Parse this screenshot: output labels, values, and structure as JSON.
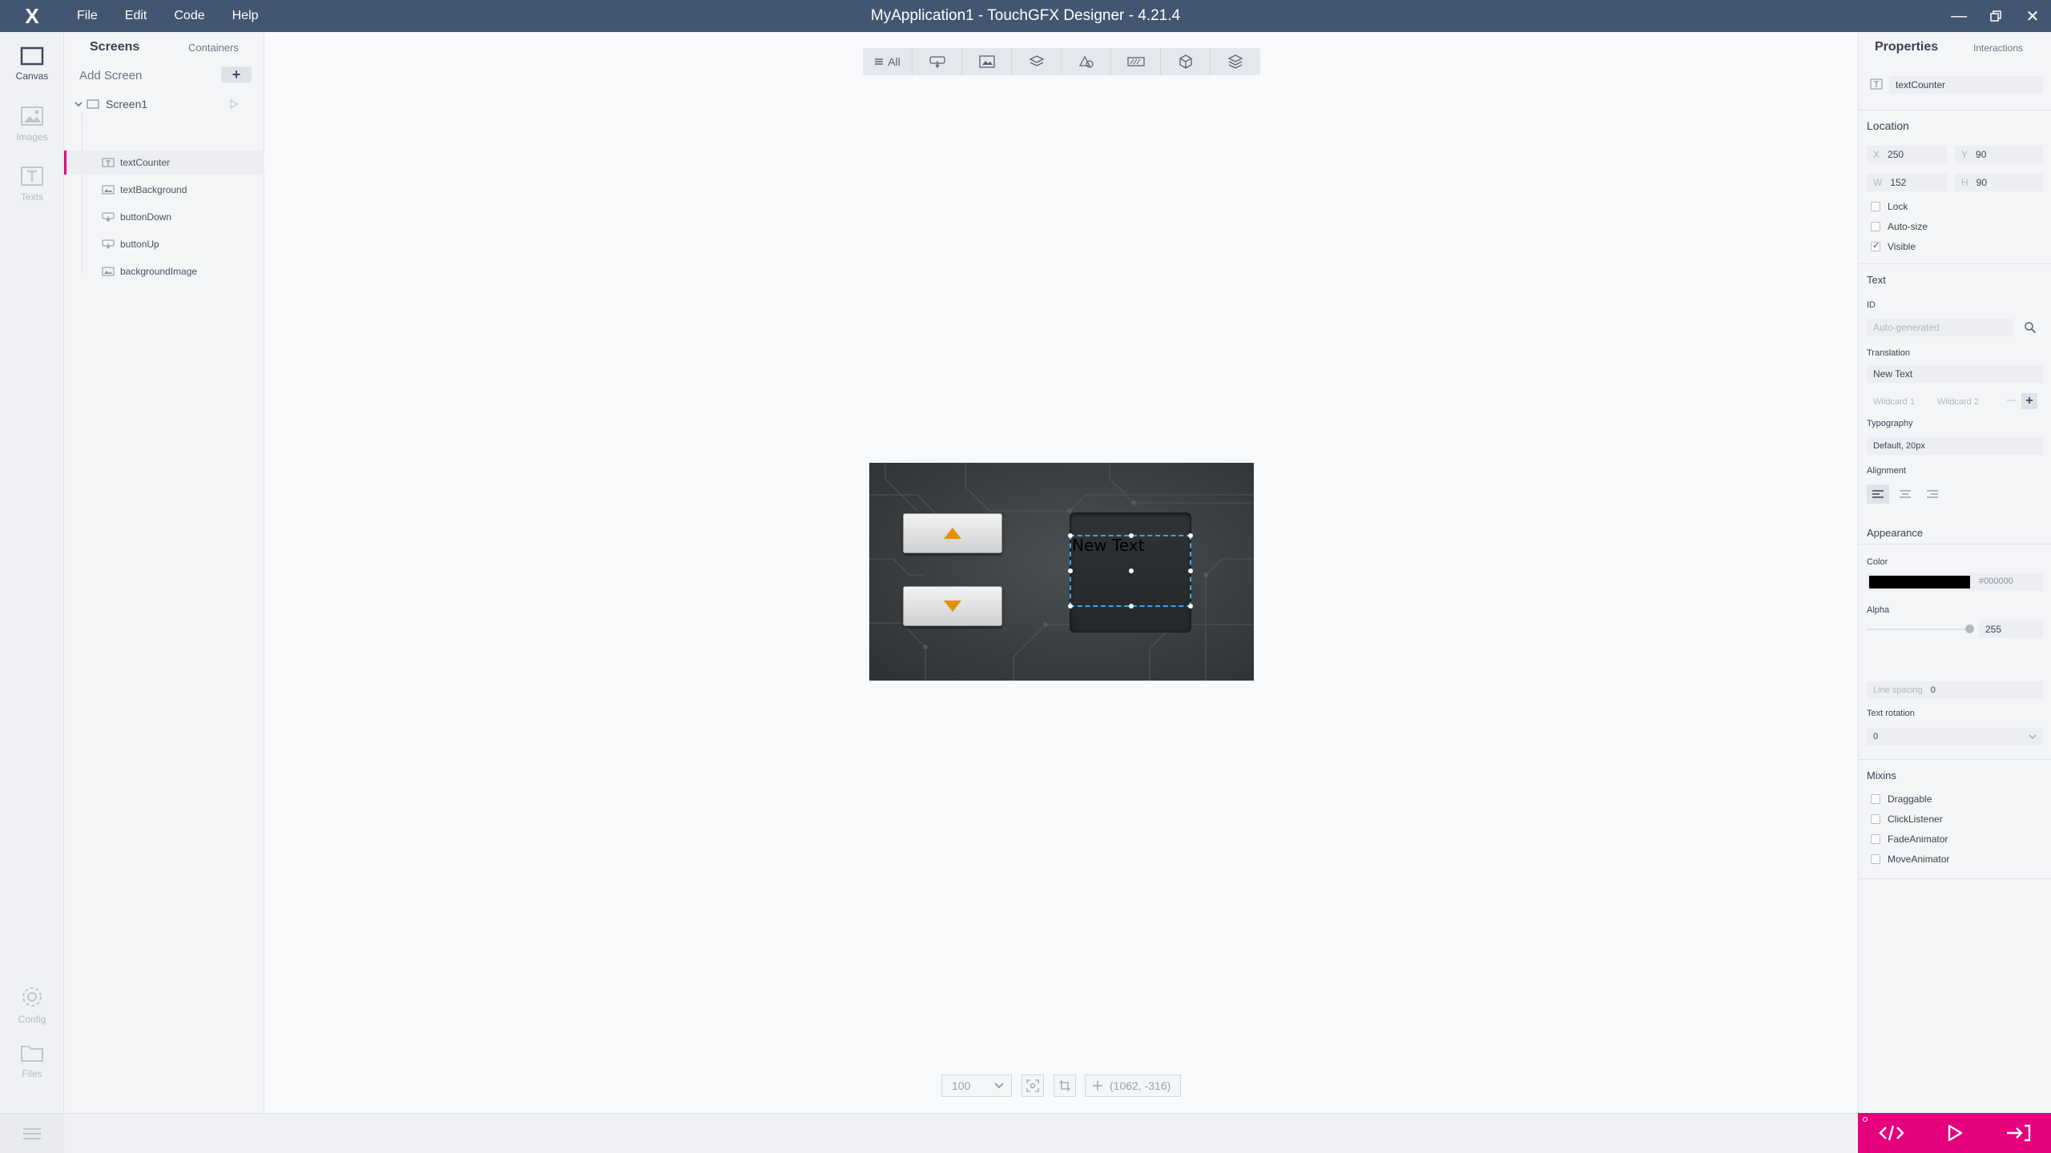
{
  "app": {
    "logo": "X",
    "title": "MyApplication1 - TouchGFX Designer - 4.21.4",
    "menu": [
      "File",
      "Edit",
      "Code",
      "Help"
    ]
  },
  "rail": {
    "canvas": "Canvas",
    "images": "Images",
    "texts": "Texts",
    "config": "Config",
    "files": "Files"
  },
  "tree": {
    "tab_screens": "Screens",
    "tab_containers": "Containers",
    "add_screen": "Add Screen",
    "add_button": "+",
    "screen_name": "Screen1",
    "widgets": [
      {
        "name": "textCounter",
        "icon": "text-icon"
      },
      {
        "name": "textBackground",
        "icon": "image-icon"
      },
      {
        "name": "buttonDown",
        "icon": "button-icon"
      },
      {
        "name": "buttonUp",
        "icon": "button-icon"
      },
      {
        "name": "backgroundImage",
        "icon": "image-icon"
      }
    ]
  },
  "canvas": {
    "filter_all": "All",
    "text_counter": "New Text",
    "zoom": "100",
    "coords": "(1062, -316)"
  },
  "properties": {
    "tab_properties": "Properties",
    "tab_interactions": "Interactions",
    "widget_name": "textCounter",
    "location": "Location",
    "x_label": "X",
    "x": "250",
    "y_label": "Y",
    "y": "90",
    "w_label": "W",
    "w": "152",
    "h_label": "H",
    "h": "90",
    "lock": "Lock",
    "auto_size": "Auto-size",
    "visible": "Visible",
    "text_section": "Text",
    "id_label": "ID",
    "id_placeholder": "Auto-generated",
    "translation_label": "Translation",
    "translation": "New Text",
    "wildcard1": "Wildcard 1",
    "wildcard2": "Wildcard 2",
    "wildcard_dash": "—",
    "wildcard_add": "+",
    "typography_label": "Typography",
    "typography": "Default, 20px",
    "alignment_label": "Alignment",
    "appearance": "Appearance",
    "color_label": "Color",
    "color_hex": "#000000",
    "alpha_label": "Alpha",
    "alpha": "255",
    "line_spacing_label": "Line spacing",
    "line_spacing": "0",
    "text_rotation_label": "Text rotation",
    "text_rotation": "0",
    "mixins": "Mixins",
    "draggable": "Draggable",
    "click_listener": "ClickListener",
    "fade_animator": "FadeAnimator",
    "move_animator": "MoveAnimator"
  },
  "colors": {
    "titlebar": "#425671",
    "accent": "#e6007e",
    "selection": "#3aa7e6",
    "arrow": "#e39100"
  }
}
